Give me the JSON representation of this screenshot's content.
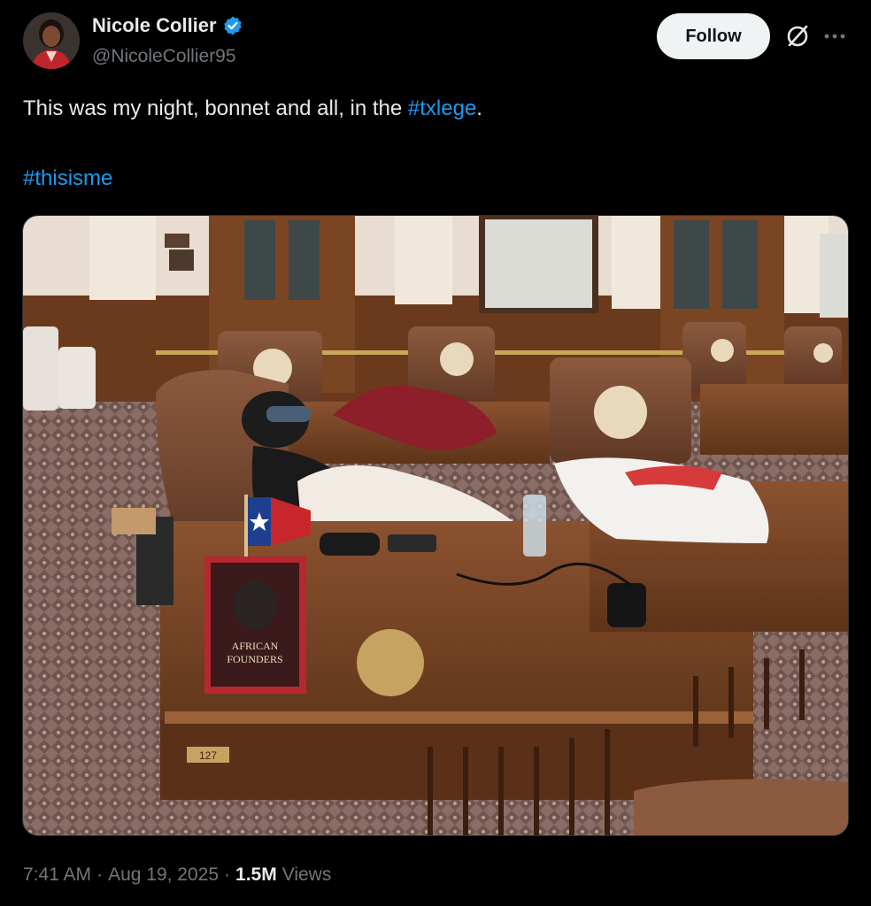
{
  "author": {
    "name": "Nicole Collier",
    "handle": "@NicoleCollier95",
    "verified": true,
    "verified_color": "#1d9bf0"
  },
  "actions": {
    "follow_label": "Follow",
    "grok_icon": "grok-icon",
    "more_icon": "more-options-icon"
  },
  "tweet": {
    "text_before": "This was my night, bonnet and all, in the ",
    "hashtag1": "#txlege",
    "text_after": ".",
    "hashtag2": "#thisisme",
    "link_color": "#1d9bf0"
  },
  "media": {
    "book_title_line1": "AFRICAN",
    "book_title_line2": "FOUNDERS",
    "desk_plate": "127"
  },
  "footer": {
    "time": "7:41 AM",
    "sep1": "·",
    "date": "Aug 19, 2025",
    "sep2": "·",
    "views_count": "1.5M",
    "views_label": "Views"
  }
}
